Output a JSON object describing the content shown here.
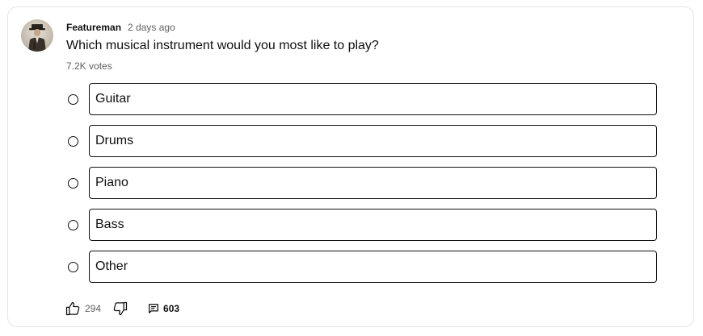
{
  "post": {
    "author": "Featureman",
    "time": "2 days ago",
    "question": "Which musical instrument would you most like to play?",
    "votes": "7.2K votes",
    "avatar_icon": "user-avatar"
  },
  "poll": {
    "options": [
      {
        "label": "Guitar"
      },
      {
        "label": "Drums"
      },
      {
        "label": "Piano"
      },
      {
        "label": "Bass"
      },
      {
        "label": "Other"
      }
    ]
  },
  "actions": {
    "like_count": "294",
    "comment_count": "603",
    "like_icon": "thumbs-up-icon",
    "dislike_icon": "thumbs-down-icon",
    "comment_icon": "comment-icon"
  },
  "colors": {
    "text": "#0f0f0f",
    "secondary_text": "#606060",
    "card_border": "#e5e5e5"
  }
}
